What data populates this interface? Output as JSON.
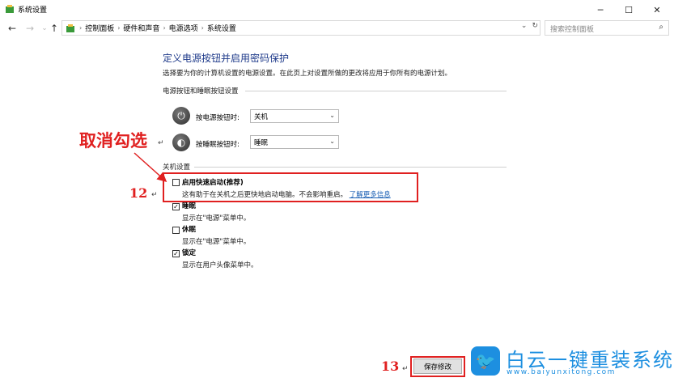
{
  "window": {
    "title": "系统设置",
    "controls": [
      "─",
      "☐",
      "✕"
    ]
  },
  "address_bar": {
    "crumbs": [
      "控制面板",
      "硬件和声音",
      "电源选项",
      "系统设置"
    ],
    "dropdown_glyph": "⌄",
    "refresh_glyph": "↻"
  },
  "search": {
    "placeholder": "搜索控制面板"
  },
  "page": {
    "heading": "定义电源按钮并启用密码保护",
    "description": "选择要为你的计算机设置的电源设置。在此页上对设置所做的更改将应用于你所有的电源计划。",
    "power_group_label": "电源按钮和睡眠按钮设置",
    "power_button_label": "按电源按钮时:",
    "power_button_value": "关机",
    "sleep_button_label": "按睡眠按钮时:",
    "sleep_button_value": "睡眠",
    "shutdown_group_label": "关机设置",
    "options": [
      {
        "title": "启用快速启动(推荐)",
        "desc": "这有助于在关机之后更快地启动电脑。不会影响重启。",
        "link": "了解更多信息",
        "checked": false
      },
      {
        "title": "睡眠",
        "desc": "显示在\"电源\"菜单中。",
        "checked": true
      },
      {
        "title": "休眠",
        "desc": "显示在\"电源\"菜单中。",
        "checked": false
      },
      {
        "title": "锁定",
        "desc": "显示在用户头像菜单中。",
        "checked": true
      }
    ],
    "save_label": "保存修改"
  },
  "annotations": {
    "cancel_check": "取消勾选",
    "step12": "12",
    "step13": "13",
    "return_mark": "↵"
  },
  "watermark": {
    "brand": "白云一键重装系统",
    "url": "www.baiyunxitong.com"
  },
  "colors": {
    "heading": "#1e3a8a",
    "annotation_red": "#e02020",
    "link": "#1a5fb4",
    "brand_blue": "#1d8fe0"
  }
}
